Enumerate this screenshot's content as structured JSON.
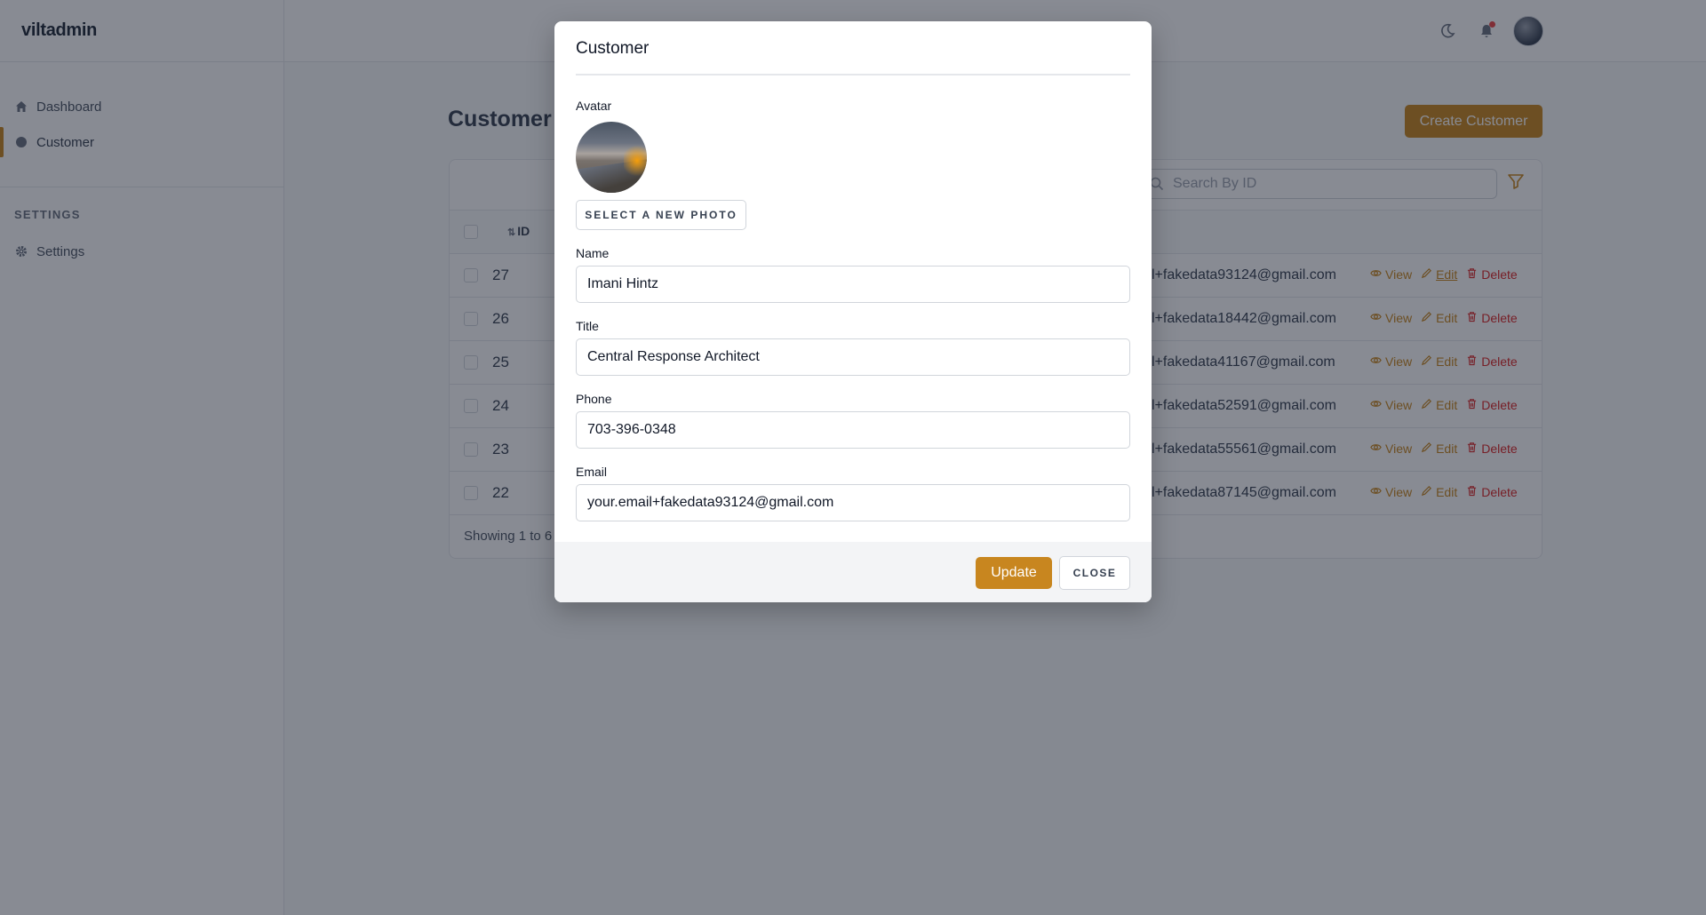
{
  "app": {
    "brand": "viltadmin"
  },
  "sidebar": {
    "items": [
      {
        "label": "Dashboard",
        "icon": "home-icon",
        "active": false
      },
      {
        "label": "Customer",
        "icon": "circle-icon",
        "active": true
      }
    ],
    "section_label": "SETTINGS",
    "settings_items": [
      {
        "label": "Settings",
        "icon": "gear-icon"
      }
    ]
  },
  "topbar": {
    "icons": [
      "moon-icon",
      "bell-icon",
      "avatar"
    ]
  },
  "main": {
    "title": "Customer",
    "create_label": "Create Customer",
    "search_placeholder": "Search By ID",
    "column_id": "ID",
    "rows": [
      {
        "id": "27",
        "email": "l+fakedata93124@gmail.com"
      },
      {
        "id": "26",
        "email": "l+fakedata18442@gmail.com"
      },
      {
        "id": "25",
        "email": "l+fakedata41167@gmail.com"
      },
      {
        "id": "24",
        "email": "l+fakedata52591@gmail.com"
      },
      {
        "id": "23",
        "email": "l+fakedata55561@gmail.com"
      },
      {
        "id": "22",
        "email": "l+fakedata87145@gmail.com"
      }
    ],
    "actions": {
      "view": "View",
      "edit": "Edit",
      "delete": "Delete"
    },
    "footer_text": "Showing 1 to 6"
  },
  "modal": {
    "title": "Customer",
    "avatar_label": "Avatar",
    "select_photo_label": "SELECT A NEW PHOTO",
    "name_label": "Name",
    "name_value": "Imani Hintz",
    "title_label": "Title",
    "title_value": "Central Response Architect",
    "phone_label": "Phone",
    "phone_value": "703-396-0348",
    "email_label": "Email",
    "email_value": "your.email+fakedata93124@gmail.com",
    "update_label": "Update",
    "close_label": "CLOSE"
  },
  "colors": {
    "accent": "#c8861f",
    "danger": "#dc2626",
    "overlay": "rgba(17,24,39,0.5)"
  }
}
